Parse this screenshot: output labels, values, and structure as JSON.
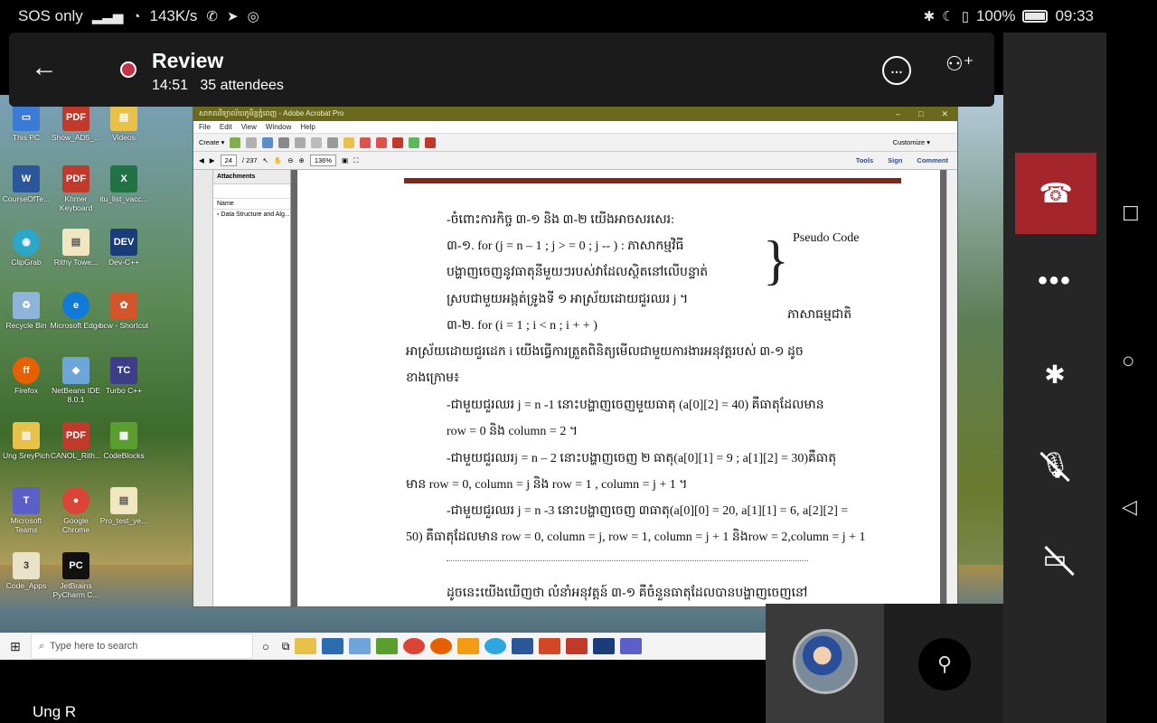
{
  "status_bar": {
    "carrier": "SOS only",
    "speed": "143K/s",
    "battery": "100%",
    "time": "09:33"
  },
  "meeting": {
    "title": "Review",
    "duration": "14:51",
    "attendees": "35 attendees",
    "presenter_name": "Ung R"
  },
  "desktop_icons": [
    {
      "label": "This PC"
    },
    {
      "label": "Show_AD5_..."
    },
    {
      "label": "Videos"
    },
    {
      "label": "CourseOfTe..."
    },
    {
      "label": "Khmer Keyboard"
    },
    {
      "label": "itu_list_vacc..."
    },
    {
      "label": "ClipGrab"
    },
    {
      "label": "Rithy Towe..."
    },
    {
      "label": "Dev-C++"
    },
    {
      "label": "Recycle Bin"
    },
    {
      "label": "Microsoft Edge"
    },
    {
      "label": "bcw - Shortcut"
    },
    {
      "label": "Firefox"
    },
    {
      "label": "NetBeans IDE 8.0.1"
    },
    {
      "label": "Turbo C++"
    },
    {
      "label": "Ung SreyPich"
    },
    {
      "label": "CANOL_Rith..."
    },
    {
      "label": "CodeBlocks"
    },
    {
      "label": "Microsoft Teams"
    },
    {
      "label": "Google Chrome"
    },
    {
      "label": "Pro_test_ye..."
    },
    {
      "label": "Code_Apps"
    },
    {
      "label": "JetBrains PyCharm C..."
    }
  ],
  "acrobat": {
    "title": "សាកលវិទ្យាល័យភូមិន្ទភ្នំពេញ - Adobe Acrobat Pro",
    "menu": [
      "File",
      "Edit",
      "View",
      "Window",
      "Help"
    ],
    "create_label": "Create",
    "customize_label": "Customize",
    "page_number": "24",
    "page_total": "/ 237",
    "zoom": "136%",
    "tool_links": [
      "Tools",
      "Sign",
      "Comment"
    ],
    "attachments_title": "Attachments",
    "attachments_col": "Name",
    "attachment_file": "Data Structure and Alg..."
  },
  "document": {
    "line1": "-ចំពោះការកិច្ច ៣-១ និង ៣-២ យើងអាចសរសេរ:",
    "line2": "៣-១. for (j = n – 1 ; j > = 0 ; j -- ) : ភាសាកម្មវិធី",
    "line3": "បង្ហាញចេញនូវធាតុនីមួយៗរបស់វាដែលស្ថិតនៅលើបន្ទាត់",
    "line4": "ស្របជាមួយអង្កត់ទ្រូងទី ១ អាស្រ័យដោយជួរឈរ j ។",
    "line5": "៣-២. for (i = 1 ; i < n ; i + + )",
    "pseudo_label": "Pseudo Code",
    "natural_label": "ភាសាធម្មជាតិ",
    "line6": "អាស្រ័យដោយជួរដេក i យើងធ្វើការត្រួតពិនិត្យមើលជាមួយការងារអនុវត្តរបស់ ៣-១ ដូច",
    "line7": "ខាងក្រោម៖",
    "line8": "-ជាមួយជួរឈរ j = n -1 នោះបង្ហាញចេញមួយធាតុ (a[0][2] = 40) គឺធាតុដែលមាន",
    "line9": "row = 0 និង column = 2 ។",
    "line10": "-ជាមួយជួរឈរj = n – 2 នោះបង្ហាញចេញ ២ ធាតុ(a[0][1] = 9 ; a[1][2] = 30)គឺធាតុ",
    "line11": "មាន row = 0, column = j និង row = 1 , column = j + 1 ។",
    "line12": "-ជាមួយជួរឈរ j = n -3 នោះបង្ហាញចេញ ៣ធាតុ(a[0][0] = 20, a[1][1] = 6, a[2][2] =",
    "line13": "50) គឺធាតុដែលមាន row = 0, column = j, row = 1, column = j + 1 និងrow = 2,column = j + 1",
    "line14": "ដូចនេះយើងឃើញថា លំនាំអនុវត្តន៍ ៣-១ គឺចំនួនធាតុដែលបានបង្ហាញចេញនៅ"
  },
  "taskbar": {
    "search_placeholder": "Type here to search"
  },
  "colors": {
    "hangup": "#a4262c",
    "recording": "#c4314b",
    "acrobat_titlebar": "#6a6a1e"
  },
  "icons": {
    "back": "arrow-left-icon",
    "chat": "chat-icon",
    "people": "add-people-icon",
    "hangup": "phone-hangup-icon",
    "more": "more-icon",
    "bluetooth": "bluetooth-icon",
    "mic": "mic-off-icon",
    "camera": "camera-off-icon"
  }
}
